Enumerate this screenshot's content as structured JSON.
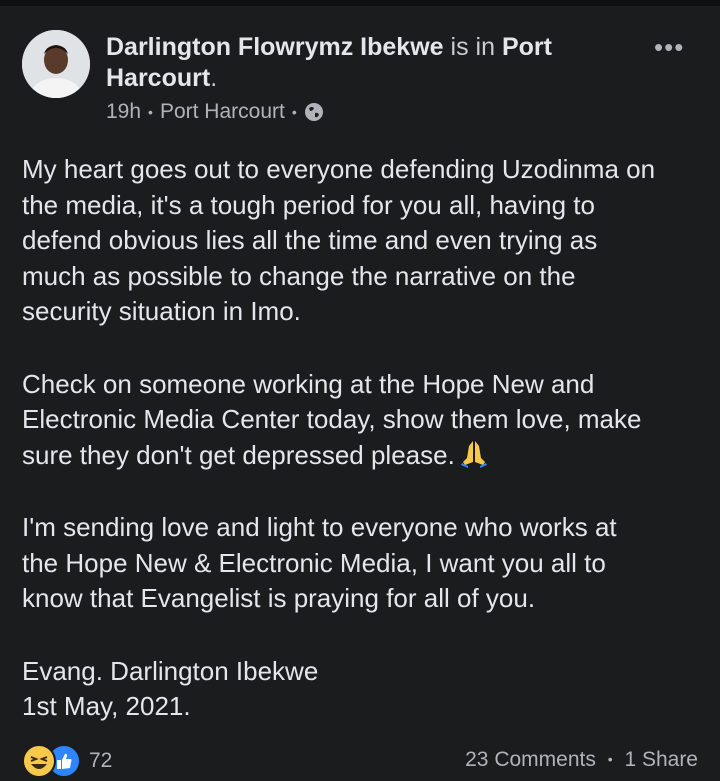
{
  "post": {
    "author": "Darlington Flowrymz Ibekwe",
    "is_in": "is in",
    "place": "Port Harcourt",
    "place_suffix": ".",
    "time": "19h",
    "location": "Port Harcourt",
    "privacy_icon": "globe-icon",
    "more_label": "•••",
    "paragraphs": [
      [
        "My heart goes out to everyone defending Uzodinma on",
        "the media, it's a tough period for you all, having to",
        "defend obvious lies all the time and even trying as",
        "much as possible to change the narrative on the",
        "security situation in Imo."
      ],
      [
        "Check on someone working at the Hope New and",
        "Electronic Media Center today, show them love, make",
        "sure they don't get depressed please."
      ],
      [
        "I'm sending love and light to everyone who works at",
        "the Hope New & Electronic Media, I want you all to",
        "know that Evangelist is praying for all of you."
      ],
      [
        "Evang. Darlington Ibekwe",
        "1st May, 2021."
      ]
    ],
    "emoji_icon": "folded-hands-icon"
  },
  "footer": {
    "reaction_icons": [
      "haha-icon",
      "like-icon"
    ],
    "reaction_count": "72",
    "comments": "23 Comments",
    "shares": "1 Share"
  },
  "colors": {
    "background": "#1b1c1e",
    "text": "#e4e6eb",
    "muted": "#b0b3b8",
    "like": "#2d86ff",
    "haha": "#f7c94a"
  }
}
